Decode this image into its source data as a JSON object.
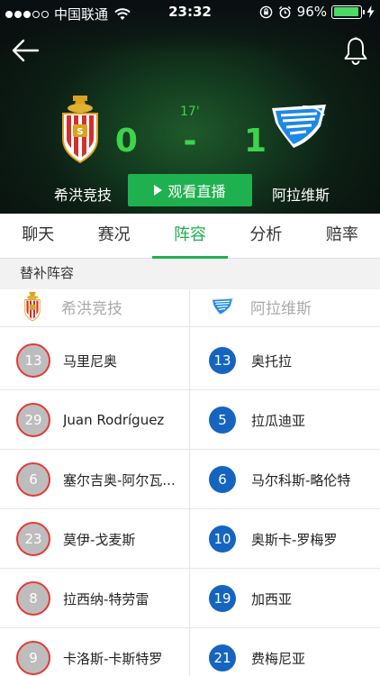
{
  "status_bar": {
    "carrier": "中国联通",
    "time": "23:32",
    "battery": "96%",
    "battery_level": 0.96
  },
  "match": {
    "minute": "17'",
    "home_score": "0",
    "separator": "-",
    "away_score": "1",
    "home_team": "希洪竞技",
    "away_team": "阿拉维斯",
    "live_button": "观看直播"
  },
  "tabs": [
    {
      "label": "聊天",
      "active": false
    },
    {
      "label": "赛况",
      "active": false
    },
    {
      "label": "阵容",
      "active": true
    },
    {
      "label": "分析",
      "active": false
    },
    {
      "label": "赔率",
      "active": false
    }
  ],
  "section_title": "替补阵容",
  "lineup": {
    "home_team": "希洪竞技",
    "away_team": "阿拉维斯",
    "rows": [
      {
        "home": {
          "number": "13",
          "name": "马里尼奥"
        },
        "away": {
          "number": "13",
          "name": "奥托拉"
        }
      },
      {
        "home": {
          "number": "29",
          "name": "Juan Rodríguez"
        },
        "away": {
          "number": "5",
          "name": "拉瓜迪亚"
        }
      },
      {
        "home": {
          "number": "6",
          "name": "塞尔吉奥-阿尔瓦..."
        },
        "away": {
          "number": "6",
          "name": "马尔科斯-略伦特"
        }
      },
      {
        "home": {
          "number": "23",
          "name": "莫伊-戈麦斯"
        },
        "away": {
          "number": "10",
          "name": "奥斯卡-罗梅罗"
        }
      },
      {
        "home": {
          "number": "8",
          "name": "拉西纳-特劳雷"
        },
        "away": {
          "number": "19",
          "name": "加西亚"
        }
      },
      {
        "home": {
          "number": "9",
          "name": "卡洛斯-卡斯特罗"
        },
        "away": {
          "number": "21",
          "name": "费梅尼亚"
        }
      }
    ]
  },
  "colors": {
    "accent_green": "#1fb14f",
    "score_green": "#3ed24d",
    "home_ring": "#e53935",
    "away_badge": "#1565c0"
  }
}
